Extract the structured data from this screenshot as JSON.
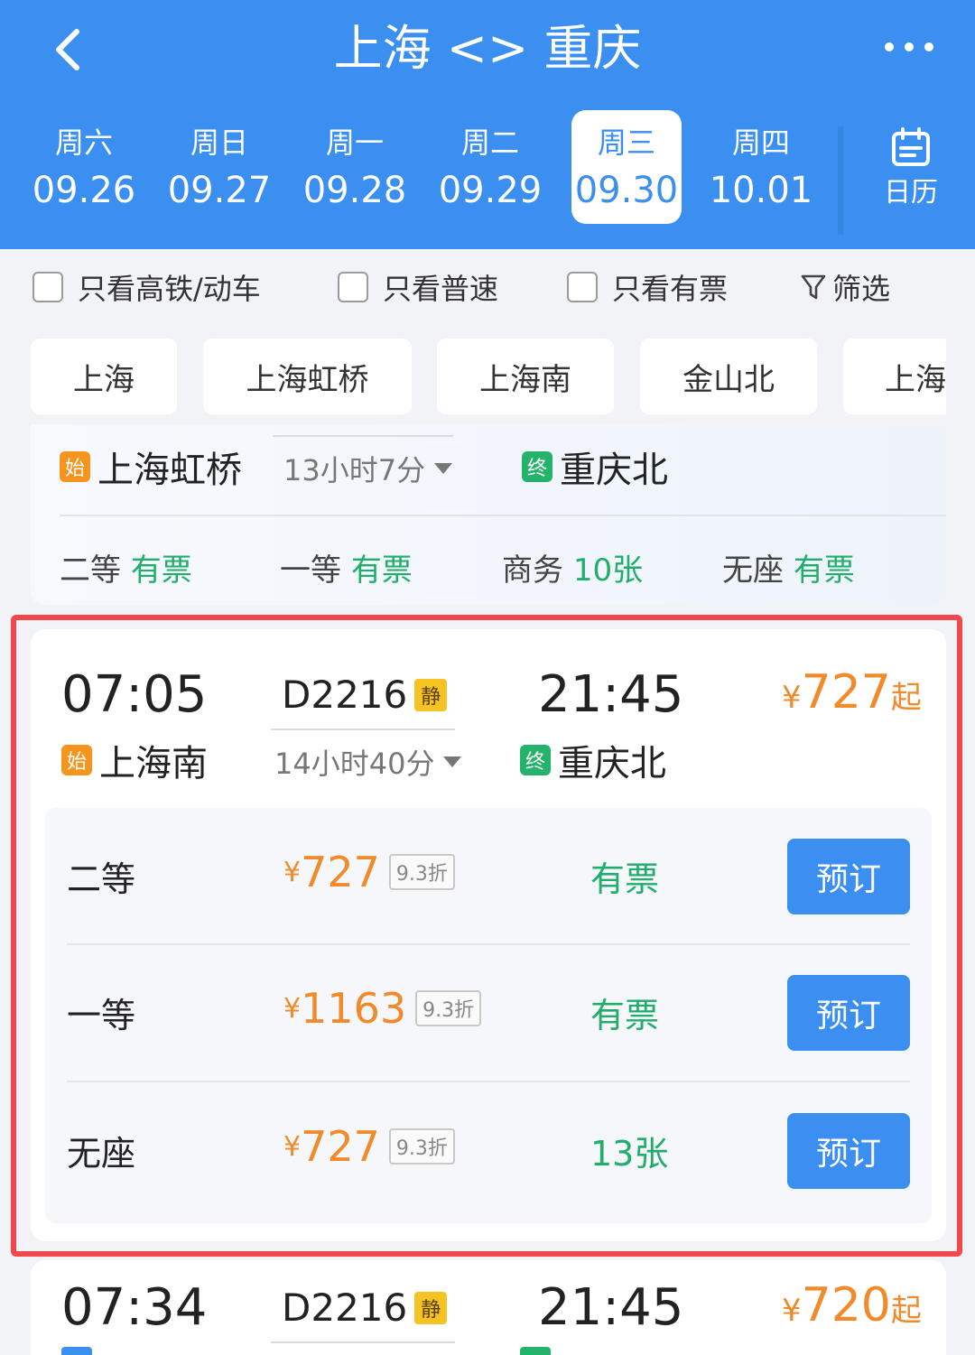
{
  "header": {
    "title": "上海 <> 重庆",
    "calendar_label": "日历"
  },
  "dates": [
    {
      "weekday": "周六",
      "date": "09.26"
    },
    {
      "weekday": "周日",
      "date": "09.27"
    },
    {
      "weekday": "周一",
      "date": "09.28"
    },
    {
      "weekday": "周二",
      "date": "09.29"
    },
    {
      "weekday": "周三",
      "date": "09.30",
      "selected": true
    },
    {
      "weekday": "周四",
      "date": "10.01"
    }
  ],
  "filters": {
    "high_speed": "只看高铁/动车",
    "normal": "只看普速",
    "available": "只看有票",
    "filter": "筛选"
  },
  "stations": [
    "上海",
    "上海虹桥",
    "上海南",
    "金山北",
    "上海"
  ],
  "card_top": {
    "from": "上海虹桥",
    "start_badge": "始",
    "duration": "13小时7分",
    "to": "重庆北",
    "end_badge": "终",
    "seats": [
      {
        "name": "二等",
        "status": "有票"
      },
      {
        "name": "一等",
        "status": "有票"
      },
      {
        "name": "商务",
        "status": "10张"
      },
      {
        "name": "无座",
        "status": "有票"
      }
    ]
  },
  "train_main": {
    "depart_time": "07:05",
    "train_no": "D2216",
    "quiet": "静",
    "arrive_time": "21:45",
    "price_currency": "¥",
    "price": "727",
    "price_suffix": "起",
    "from": "上海南",
    "start_badge": "始",
    "duration": "14小时40分",
    "to": "重庆北",
    "end_badge": "终",
    "seats": [
      {
        "name": "二等",
        "currency": "¥",
        "price": "727",
        "discount": "9.3折",
        "avail": "有票",
        "book": "预订"
      },
      {
        "name": "一等",
        "currency": "¥",
        "price": "1163",
        "discount": "9.3折",
        "avail": "有票",
        "book": "预订"
      },
      {
        "name": "无座",
        "currency": "¥",
        "price": "727",
        "discount": "9.3折",
        "avail": "13张",
        "book": "预订"
      }
    ]
  },
  "train_next": {
    "depart_time": "07:34",
    "train_no": "D2216",
    "quiet": "静",
    "arrive_time": "21:45",
    "price_currency": "¥",
    "price": "720",
    "price_suffix": "起"
  },
  "colors": {
    "brand_blue": "#3b8ff0",
    "price_orange": "#f08a2a",
    "available_green": "#21ae6a",
    "highlight_red": "#f4474c"
  }
}
